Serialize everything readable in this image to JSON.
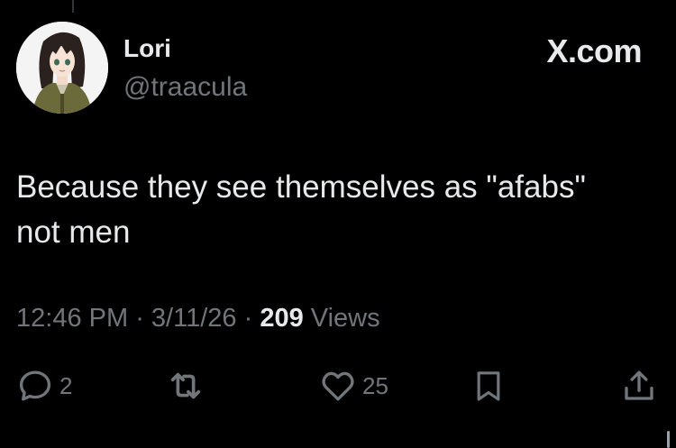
{
  "brand": {
    "label": "X.com",
    "icon": "x-logo-icon"
  },
  "author": {
    "display_name": "Lori",
    "handle": "@traacula",
    "avatar_icon": "anime-avatar"
  },
  "tweet": {
    "lines": [
      "Because they see themselves as \"afabs\"",
      "not men"
    ]
  },
  "meta": {
    "time": "12:46 PM",
    "separator": " · ",
    "date": "3/11/26",
    "views_count": "209",
    "views_label": " Views"
  },
  "actions": {
    "reply": {
      "icon": "reply-icon",
      "count": "2"
    },
    "retweet": {
      "icon": "retweet-icon",
      "count": ""
    },
    "like": {
      "icon": "heart-icon",
      "count": "25"
    },
    "bookmark": {
      "icon": "bookmark-icon",
      "count": ""
    },
    "share": {
      "icon": "share-icon",
      "count": ""
    }
  },
  "colors": {
    "background": "#000000",
    "primary_text": "#e7e9ea",
    "secondary_text": "#71767b"
  }
}
